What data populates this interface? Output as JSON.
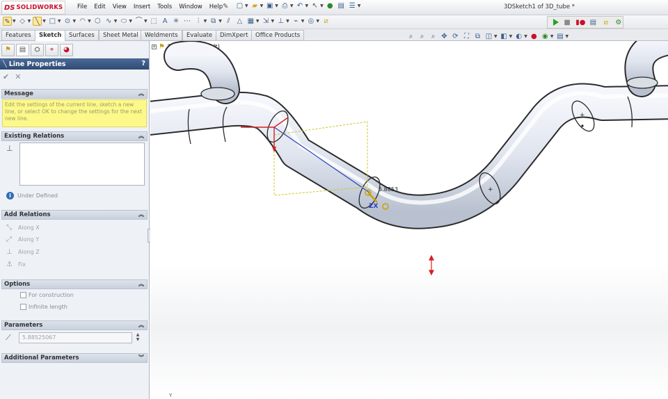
{
  "app": {
    "logo_mark": "DS",
    "logo_text": "SOLIDWORKS",
    "document_title": "3DSketch1 of 3D_tube *"
  },
  "menu": [
    "File",
    "Edit",
    "View",
    "Insert",
    "Tools",
    "Window",
    "Help"
  ],
  "command_tabs": [
    "Features",
    "Sketch",
    "Surfaces",
    "Sheet Metal",
    "Weldments",
    "Evaluate",
    "DimXpert",
    "Office Products"
  ],
  "active_tab": "Sketch",
  "property_manager": {
    "title": "Line Properties",
    "help": "?",
    "ok_glyph": "✔",
    "cancel_glyph": "✕",
    "sections": {
      "message": {
        "label": "Message",
        "text": "Edit the settings of the current line, sketch a new line, or select OK to change the settings for the next new line."
      },
      "existing_relations": {
        "label": "Existing Relations",
        "status": "Under Defined"
      },
      "add_relations": {
        "label": "Add Relations",
        "items": [
          "Along X",
          "Along Y",
          "Along Z",
          "Fix"
        ]
      },
      "options": {
        "label": "Options",
        "items": [
          "For construction",
          "Infinite length"
        ]
      },
      "parameters": {
        "label": "Parameters",
        "length_value": "5.88525067"
      },
      "additional_parameters": {
        "label": "Additional Parameters"
      }
    }
  },
  "viewport": {
    "tree_label": "3D_tube  (Default)",
    "dimension_readout": "5.8853",
    "triad_axes": "ZX",
    "axis_hint": "Y"
  },
  "colors": {
    "accent": "#2f4a74",
    "message_bg": "#fcf98a",
    "sketch_line": "#2b3fbf",
    "selection_box": "#c8c81e",
    "dimension_arrow": "#d62020"
  }
}
